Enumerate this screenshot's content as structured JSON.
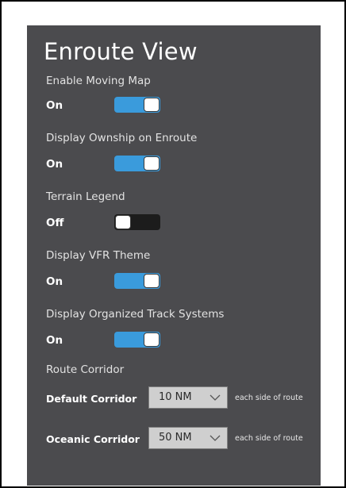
{
  "page": {
    "title": "Enroute View"
  },
  "settings": [
    {
      "label": "Enable Moving Map",
      "state": "On"
    },
    {
      "label": "Display Ownship on Enroute",
      "state": "On"
    },
    {
      "label": "Terrain Legend",
      "state": "Off"
    },
    {
      "label": "Display VFR Theme",
      "state": "On"
    },
    {
      "label": "Display Organized Track Systems",
      "state": "On"
    }
  ],
  "route_corridor": {
    "heading": "Route Corridor",
    "default": {
      "label": "Default Corridor",
      "value": "10 NM",
      "suffix": "each side of route"
    },
    "oceanic": {
      "label": "Oceanic Corridor",
      "value": "50 NM",
      "suffix": "each side of route"
    }
  },
  "colors": {
    "panel_bg": "#4b4b4e",
    "toggle_on": "#3a9bdc",
    "toggle_off": "#1c1c1c",
    "dropdown_bg": "#cfcfcf"
  },
  "icons": {
    "dropdown": "chevron-down-icon"
  }
}
